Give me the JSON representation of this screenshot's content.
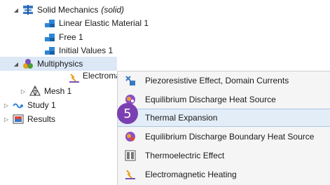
{
  "tree": {
    "solid_mechanics": {
      "label": "Solid Mechanics",
      "tag": "(solid)"
    },
    "linear_elastic": {
      "label": "Linear Elastic Material 1"
    },
    "free": {
      "label": "Free 1"
    },
    "initial_values": {
      "label": "Initial Values 1"
    },
    "multiphysics": {
      "label": "Multiphysics"
    },
    "electromag_clipped": {
      "label": "Electromag"
    },
    "mesh": {
      "label": "Mesh 1"
    },
    "study": {
      "label": "Study 1"
    },
    "results": {
      "label": "Results"
    }
  },
  "context_menu": {
    "items": [
      {
        "label": "Piezoresistive Effect, Domain Currents",
        "icon": "piezoresistive-icon"
      },
      {
        "label": "Equilibrium Discharge Heat Source",
        "icon": "discharge-heat-icon"
      },
      {
        "label": "Thermal Expansion",
        "icon": "thermal-expansion-icon"
      },
      {
        "label": "Equilibrium Discharge Boundary Heat Source",
        "icon": "boundary-heat-icon"
      },
      {
        "label": "Thermoelectric Effect",
        "icon": "thermoelectric-icon"
      },
      {
        "label": "Electromagnetic Heating",
        "icon": "em-heating-icon"
      }
    ]
  },
  "step_badge": {
    "number": "5"
  },
  "colors": {
    "badge": "#7a3fb0",
    "highlight": "#e3edf7",
    "selected_row": "#dce8f6"
  }
}
